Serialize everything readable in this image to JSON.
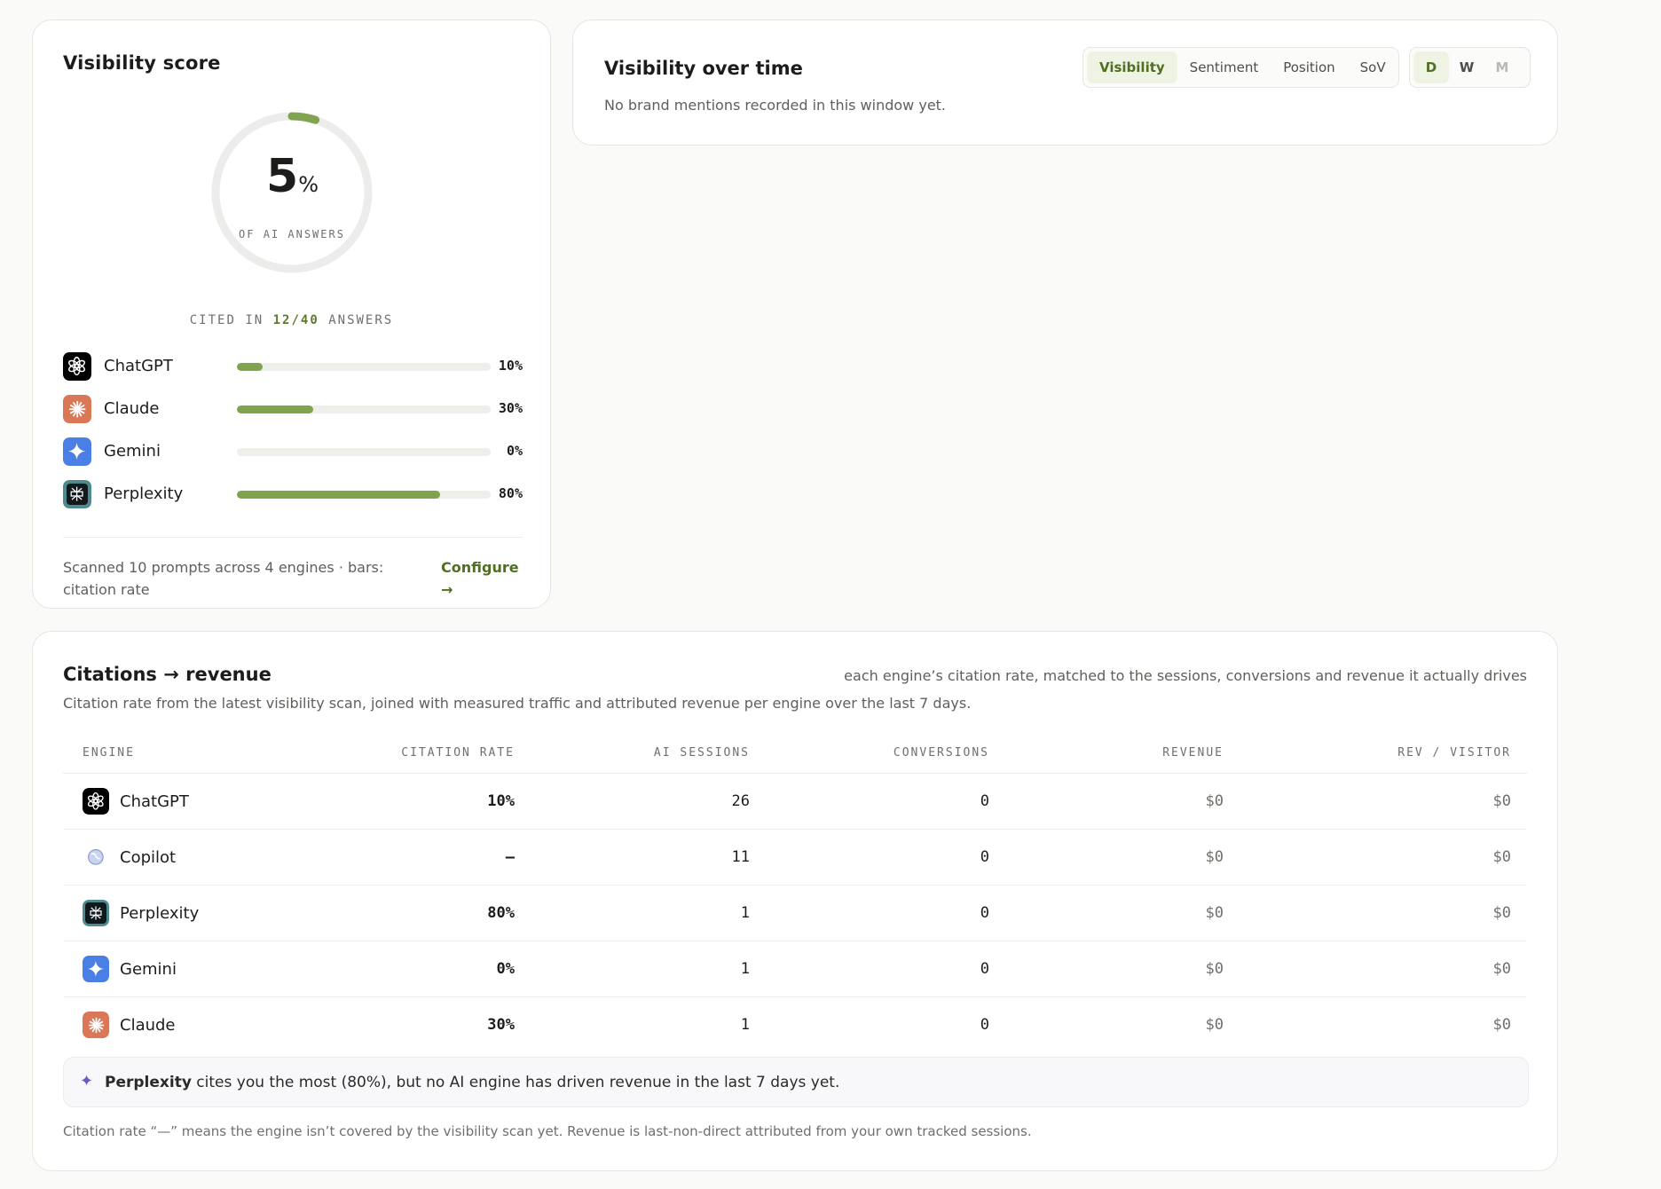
{
  "score": {
    "title": "Visibility score",
    "value": "5",
    "value_fraction": 0.05,
    "unit": "%",
    "caption": "OF AI ANSWERS",
    "cited_prefix": "CITED IN",
    "cited_count": "12/40",
    "cited_suffix": "ANSWERS",
    "engines": [
      {
        "name": "ChatGPT",
        "icon": "chatgpt-icon",
        "pct": "10%",
        "rate": 0.1
      },
      {
        "name": "Claude",
        "icon": "claude-icon",
        "pct": "30%",
        "rate": 0.3
      },
      {
        "name": "Gemini",
        "icon": "gemini-icon",
        "pct": "0%",
        "rate": 0.0
      },
      {
        "name": "Perplexity",
        "icon": "perplexity-icon",
        "pct": "80%",
        "rate": 0.8
      }
    ],
    "footer": "Scanned 10 prompts across 4 engines · bars: citation rate",
    "configure_label": "Configure",
    "configure_arrow": "→"
  },
  "over_time": {
    "title": "Visibility over time",
    "empty_text": "No brand mentions recorded in this window yet.",
    "metric_tabs": [
      {
        "label": "Visibility",
        "active": true
      },
      {
        "label": "Sentiment",
        "active": false
      },
      {
        "label": "Position",
        "active": false
      },
      {
        "label": "SoV",
        "active": false
      }
    ],
    "range_tabs": [
      {
        "label": "D",
        "active": true
      },
      {
        "label": "W",
        "active": false
      },
      {
        "label": "M",
        "active": false,
        "disabled": true
      }
    ]
  },
  "revenue": {
    "title": "Citations → revenue",
    "tagline": "each engine’s citation rate, matched to the sessions, conversions and revenue it actually drives",
    "subtitle": "Citation rate from the latest visibility scan, joined with measured traffic and attributed revenue per engine over the last 7 days.",
    "columns": [
      "ENGINE",
      "CITATION RATE",
      "AI SESSIONS",
      "CONVERSIONS",
      "REVENUE",
      "REV / VISITOR"
    ],
    "rows": [
      {
        "engine": "ChatGPT",
        "icon": "chatgpt-icon",
        "citation_rate": "10%",
        "sessions": "26",
        "conversions": "0",
        "revenue": "$0",
        "rev_per_visitor": "$0"
      },
      {
        "engine": "Copilot",
        "icon": "copilot-icon",
        "citation_rate": "—",
        "sessions": "11",
        "conversions": "0",
        "revenue": "$0",
        "rev_per_visitor": "$0"
      },
      {
        "engine": "Perplexity",
        "icon": "perplexity-icon",
        "citation_rate": "80%",
        "sessions": "1",
        "conversions": "0",
        "revenue": "$0",
        "rev_per_visitor": "$0"
      },
      {
        "engine": "Gemini",
        "icon": "gemini-icon",
        "citation_rate": "0%",
        "sessions": "1",
        "conversions": "0",
        "revenue": "$0",
        "rev_per_visitor": "$0"
      },
      {
        "engine": "Claude",
        "icon": "claude-icon",
        "citation_rate": "30%",
        "sessions": "1",
        "conversions": "0",
        "revenue": "$0",
        "rev_per_visitor": "$0"
      }
    ],
    "insight_icon": "sparkle-icon",
    "insight_glyph": "✦",
    "insight_bold": "Perplexity",
    "insight_rest": " cites you the most (80%), but no AI engine has driven revenue in the last 7 days yet.",
    "footnote": "Citation rate “—” means the engine isn’t covered by the visibility scan yet. Revenue is last-non-direct attributed from your own tracked sessions."
  },
  "colors": {
    "accent": "#7fa34f",
    "accent_dark": "#4f6f22",
    "track": "#eeeeea",
    "chatgpt": "#000000",
    "claude": "#d97757",
    "gemini": "#4a7fe6",
    "perplexity": "#1f4a4f",
    "copilot": "#8a9fd6"
  }
}
